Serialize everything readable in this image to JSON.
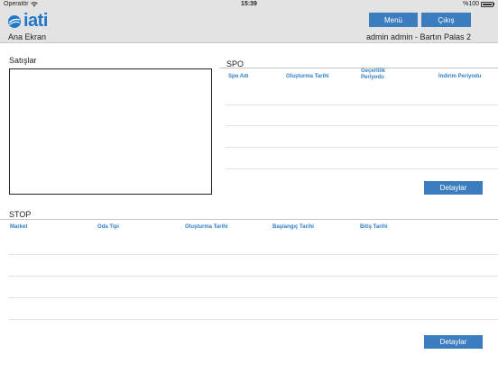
{
  "status": {
    "carrier": "Operatör",
    "time": "15:39",
    "battery": "%100"
  },
  "header": {
    "logo_text": "iati",
    "menu_label": "Menü",
    "logout_label": "Çıkış",
    "breadcrumb": "Ana Ekran",
    "user": "admin admin - Bartın Palas 2"
  },
  "sales": {
    "title": "Satışlar"
  },
  "spo": {
    "title": "SPO",
    "columns": [
      "Spo Adı",
      "Oluşturma Tarihi",
      "Geçerlilik Periyodu",
      "İndirim Periyodu"
    ],
    "detail_label": "Detaylar"
  },
  "stop": {
    "title": "STOP",
    "columns": [
      "Market",
      "Oda Tipi",
      "Oluşturma Tarihi",
      "Başlangıç Tarihi",
      "Bitiş Tarihi"
    ],
    "detail_label": "Detaylar"
  },
  "colors": {
    "accent": "#3c7dbf",
    "header_text": "#2f7fc9",
    "bar_bg": "#e3e3e3"
  },
  "icons": {
    "wifi": "wifi-icon",
    "battery": "battery-icon",
    "logo": "globe-icon"
  }
}
